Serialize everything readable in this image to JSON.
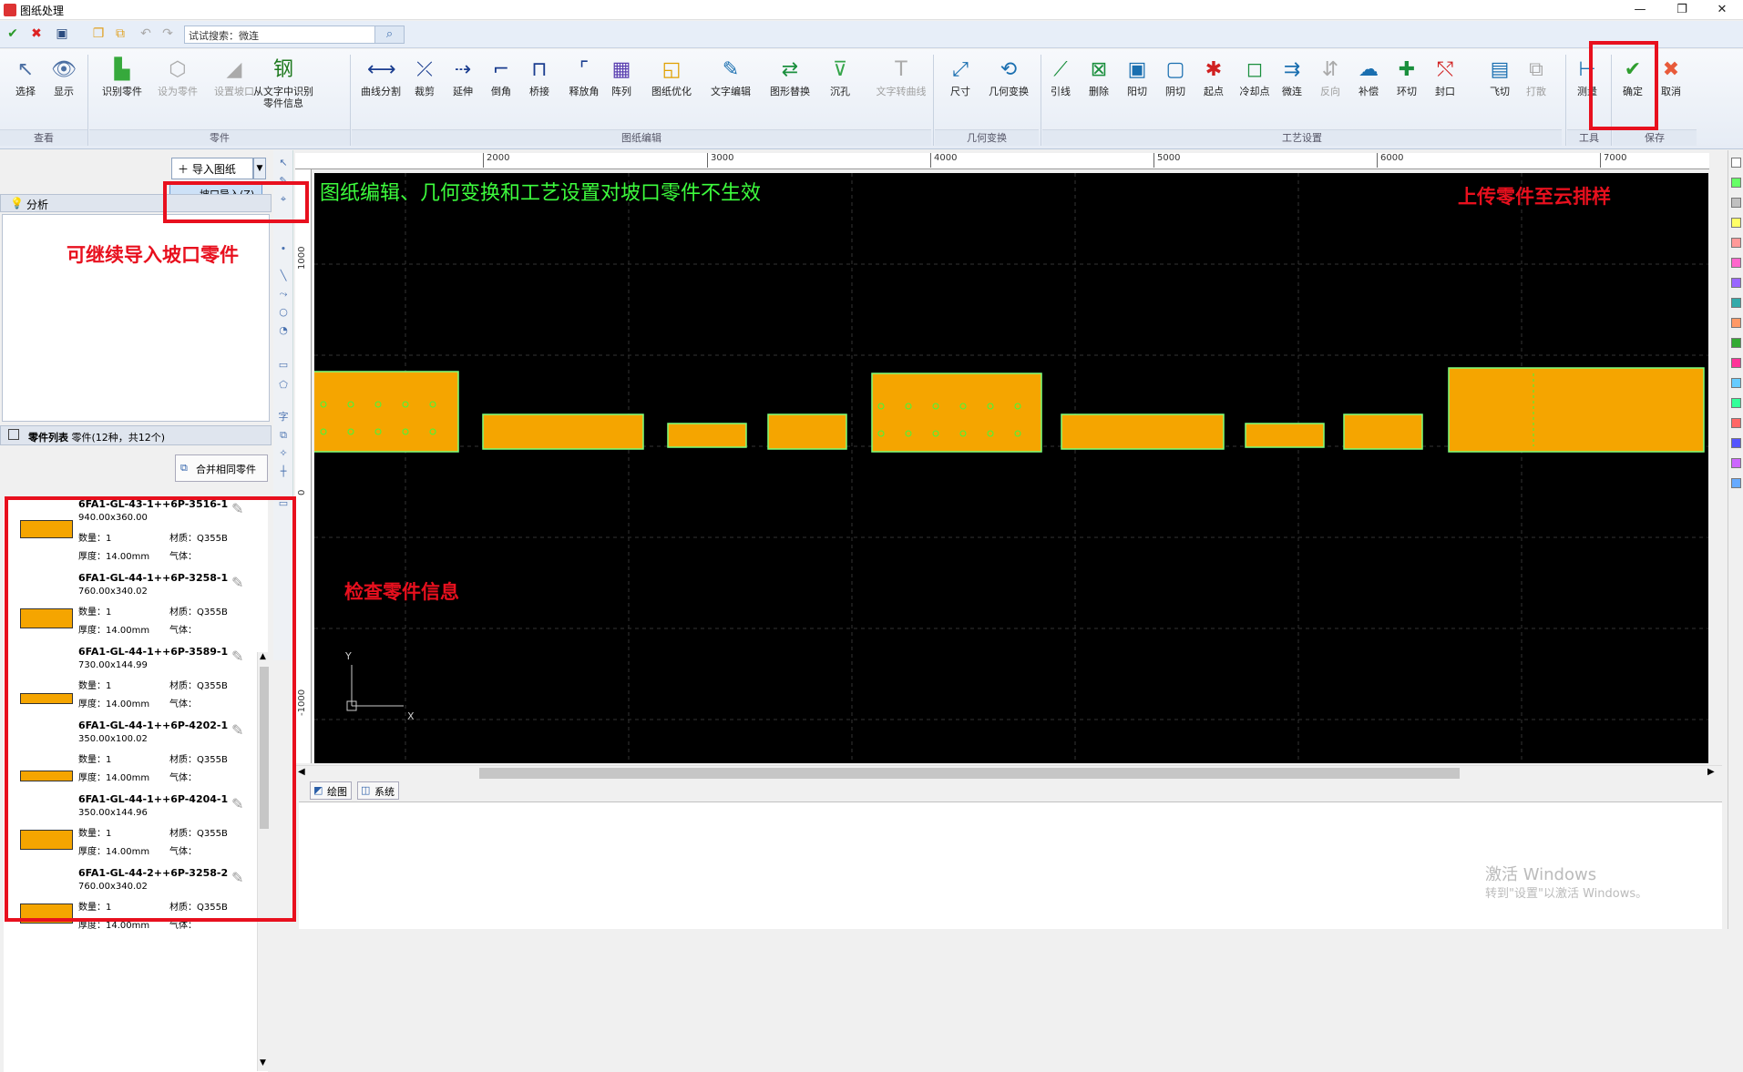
{
  "window": {
    "title": "图纸处理",
    "buttons": [
      "—",
      "❐",
      "✕"
    ]
  },
  "qat": {
    "search_value": "试试搜索：微连"
  },
  "ribbon": {
    "groups": [
      {
        "label": "查看"
      },
      {
        "label": "零件"
      },
      {
        "label": "图纸编辑"
      },
      {
        "label": "几何变换"
      },
      {
        "label": "工艺设置"
      },
      {
        "label": "工具"
      },
      {
        "label": "保存"
      }
    ],
    "buttons": [
      {
        "label": "选择",
        "icon": "↖",
        "color": "#4b6fa3"
      },
      {
        "label": "显示",
        "icon": "👁",
        "color": "#4b6fa3"
      },
      {
        "label": "识别零件",
        "icon": "▙",
        "color": "#36a93c"
      },
      {
        "label": "设为零件",
        "icon": "⬡",
        "color": "#aaaaaa"
      },
      {
        "label": "设置坡口",
        "icon": "◢",
        "color": "#aaaaaa"
      },
      {
        "label": "从文字中识别\n零件信息",
        "icon": "钢",
        "color": "#1f7a1f"
      },
      {
        "label": "曲线分割",
        "icon": "⟷",
        "color": "#1a3d8f"
      },
      {
        "label": "裁剪",
        "icon": "⤫",
        "color": "#1a3d8f"
      },
      {
        "label": "延伸",
        "icon": "⇢",
        "color": "#1a3d8f"
      },
      {
        "label": "倒角",
        "icon": "⌐",
        "color": "#1a3d8f"
      },
      {
        "label": "桥接",
        "icon": "⊓",
        "color": "#1a3d8f"
      },
      {
        "label": "释放角",
        "icon": "⌜",
        "color": "#1a3d8f"
      },
      {
        "label": "阵列",
        "icon": "▦",
        "color": "#5a3fb0"
      },
      {
        "label": "图纸优化",
        "icon": "◱",
        "color": "#e0a000"
      },
      {
        "label": "文字编辑",
        "icon": "✎",
        "color": "#1a6fb0"
      },
      {
        "label": "图形替换",
        "icon": "⇄",
        "color": "#1a8f3d"
      },
      {
        "label": "沉孔",
        "icon": "⊽",
        "color": "#35a54a"
      },
      {
        "label": "文字转曲线",
        "icon": "T",
        "color": "#aaaaaa"
      },
      {
        "label": "尺寸",
        "icon": "⤢",
        "color": "#1a6fb0"
      },
      {
        "label": "几何变换",
        "icon": "⟲",
        "color": "#1a6fb0"
      },
      {
        "label": "引线",
        "icon": "⟋",
        "color": "#1a8f3d"
      },
      {
        "label": "删除",
        "icon": "⊠",
        "color": "#1a8f3d"
      },
      {
        "label": "阳切",
        "icon": "▣",
        "color": "#1a6fb0"
      },
      {
        "label": "阴切",
        "icon": "▢",
        "color": "#1a6fb0"
      },
      {
        "label": "起点",
        "icon": "✱",
        "color": "#d02020"
      },
      {
        "label": "冷却点",
        "icon": "◻",
        "color": "#1a8f3d"
      },
      {
        "label": "微连",
        "icon": "⇉",
        "color": "#1a6fb0"
      },
      {
        "label": "反向",
        "icon": "⇵",
        "color": "#aaaaaa"
      },
      {
        "label": "补偿",
        "icon": "☁",
        "color": "#1a6fb0"
      },
      {
        "label": "环切",
        "icon": "✚",
        "color": "#1a8f3d"
      },
      {
        "label": "封口",
        "icon": "⤲",
        "color": "#d02020"
      },
      {
        "label": "飞切",
        "icon": "▤",
        "color": "#1a6fb0"
      },
      {
        "label": "打散",
        "icon": "⧉",
        "color": "#aaaaaa"
      },
      {
        "label": "测量",
        "icon": "⊢",
        "color": "#1a6fb0"
      },
      {
        "label": "确定",
        "icon": "✔",
        "color": "#2f9e2f"
      },
      {
        "label": "取消",
        "icon": "✖",
        "color": "#e85a3a"
      }
    ]
  },
  "left": {
    "import_label": "导入图纸",
    "menu_item": "坡口导入(Z)",
    "analysis_label": "分析",
    "parts_header_label": "零件列表",
    "parts_header_info": "零件(12种，共12个)",
    "merge_label": "合并相同零件"
  },
  "parts": [
    {
      "name": "6FA1-GL-43-1++6P-3516-1",
      "dims": "940.00x360.00",
      "qty": "数量：1",
      "mat": "材质：Q355B",
      "thk": "厚度：14.00mm",
      "gas": "气体："
    },
    {
      "name": "6FA1-GL-44-1++6P-3258-1",
      "dims": "760.00x340.02",
      "qty": "数量：1",
      "mat": "材质：Q355B",
      "thk": "厚度：14.00mm",
      "gas": "气体："
    },
    {
      "name": "6FA1-GL-44-1++6P-3589-1",
      "dims": "730.00x144.99",
      "qty": "数量：1",
      "mat": "材质：Q355B",
      "thk": "厚度：14.00mm",
      "gas": "气体："
    },
    {
      "name": "6FA1-GL-44-1++6P-4202-1",
      "dims": "350.00x100.02",
      "qty": "数量：1",
      "mat": "材质：Q355B",
      "thk": "厚度：14.00mm",
      "gas": "气体："
    },
    {
      "name": "6FA1-GL-44-1++6P-4204-1",
      "dims": "350.00x144.96",
      "qty": "数量：1",
      "mat": "材质：Q355B",
      "thk": "厚度：14.00mm",
      "gas": "气体："
    },
    {
      "name": "6FA1-GL-44-2++6P-3258-2",
      "dims": "760.00x340.02",
      "qty": "数量：1",
      "mat": "材质：Q355B",
      "thk": "厚度：14.00mm",
      "gas": "气体："
    }
  ],
  "ruler": {
    "h": [
      "2000",
      "3000",
      "4000",
      "5000",
      "6000",
      "7000"
    ],
    "v": [
      "1000",
      "0",
      "-1000"
    ]
  },
  "canvas": {
    "message": "图纸编辑、几何变换和工艺设置对坡口零件不生效",
    "axis_x": "X",
    "axis_y": "Y"
  },
  "tabs": [
    "绘图",
    "系统"
  ],
  "watermark": {
    "line1": "激活 Windows",
    "line2": "转到\"设置\"以激活 Windows。"
  },
  "annotations": {
    "continue_import": "可继续导入坡口零件",
    "upload": "上传零件至云排样",
    "check_info": "检查零件信息"
  },
  "palette": [
    "#ffffff",
    "#66ff66",
    "#c0c0c0",
    "#ffff66",
    "#ff9999",
    "#ff66cc",
    "#9966ff",
    "#33aaaa",
    "#ff9966",
    "#33aa33",
    "#ff3399",
    "#66ccff",
    "#33ff99",
    "#ff6666",
    "#5555ff",
    "#cc66ff",
    "#66aaff"
  ]
}
